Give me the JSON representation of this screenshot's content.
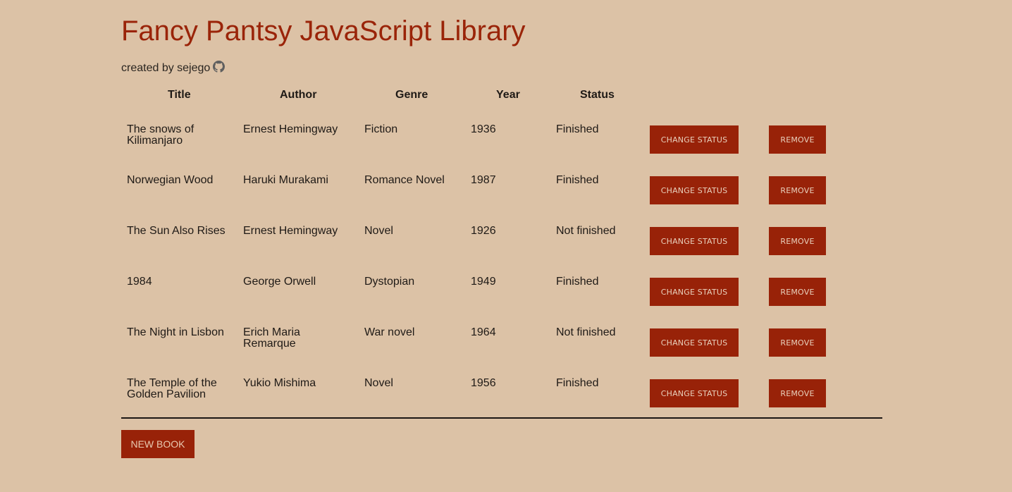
{
  "header": {
    "title": "Fancy Pantsy JavaScript Library",
    "credit": "created by sejego",
    "credit_icon": "github-icon"
  },
  "table": {
    "columns": [
      "Title",
      "Author",
      "Genre",
      "Year",
      "Status"
    ],
    "rows": [
      {
        "title": "The snows of Kilimanjaro",
        "author": "Ernest Hemingway",
        "genre": "Fiction",
        "year": "1936",
        "status": "Finished",
        "change_status_label": "CHANGE STATUS",
        "remove_label": "REMOVE"
      },
      {
        "title": "Norwegian Wood",
        "author": "Haruki Murakami",
        "genre": "Romance Novel",
        "year": "1987",
        "status": "Finished",
        "change_status_label": "CHANGE STATUS",
        "remove_label": "REMOVE"
      },
      {
        "title": "The Sun Also Rises",
        "author": "Ernest Hemingway",
        "genre": "Novel",
        "year": "1926",
        "status": "Not finished",
        "change_status_label": "CHANGE STATUS",
        "remove_label": "REMOVE"
      },
      {
        "title": "1984",
        "author": "George Orwell",
        "genre": "Dystopian",
        "year": "1949",
        "status": "Finished",
        "change_status_label": "CHANGE STATUS",
        "remove_label": "REMOVE"
      },
      {
        "title": "The Night in Lisbon",
        "author": "Erich Maria Remarque",
        "genre": "War novel",
        "year": "1964",
        "status": "Not finished",
        "change_status_label": "CHANGE STATUS",
        "remove_label": "REMOVE"
      },
      {
        "title": "The Temple of the Golden Pavilion",
        "author": "Yukio Mishima",
        "genre": "Novel",
        "year": "1956",
        "status": "Finished",
        "change_status_label": "CHANGE STATUS",
        "remove_label": "REMOVE"
      }
    ]
  },
  "footer": {
    "new_book_label": "NEW BOOK"
  },
  "colors": {
    "background": "#dcc2a6",
    "accent": "#982208",
    "title": "#9a2409",
    "text": "#1f1a16"
  }
}
